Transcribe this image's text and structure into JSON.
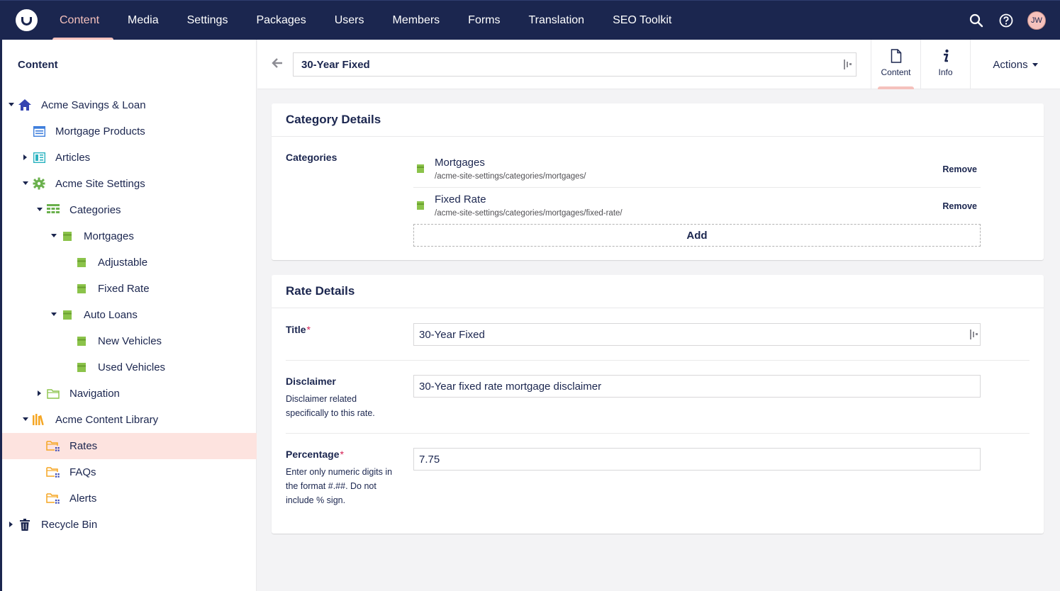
{
  "topnav": {
    "items": [
      "Content",
      "Media",
      "Settings",
      "Packages",
      "Users",
      "Members",
      "Forms",
      "Translation",
      "SEO Toolkit"
    ],
    "active": "Content",
    "avatar_initials": "JW"
  },
  "sidebar": {
    "title": "Content",
    "tree": [
      {
        "label": "Acme Savings & Loan",
        "icon": "home-icon",
        "caret": "down"
      },
      {
        "label": "Mortgage Products",
        "icon": "list-page-icon",
        "caret": ""
      },
      {
        "label": "Articles",
        "icon": "articles-icon",
        "caret": "right"
      },
      {
        "label": "Acme Site Settings",
        "icon": "gear-icon",
        "caret": "down"
      },
      {
        "label": "Categories",
        "icon": "grid-icon",
        "caret": "down"
      },
      {
        "label": "Mortgages",
        "icon": "category-icon",
        "caret": "down"
      },
      {
        "label": "Adjustable",
        "icon": "category-icon",
        "caret": ""
      },
      {
        "label": "Fixed Rate",
        "icon": "category-icon",
        "caret": ""
      },
      {
        "label": "Auto Loans",
        "icon": "category-icon",
        "caret": "down"
      },
      {
        "label": "New Vehicles",
        "icon": "category-icon",
        "caret": ""
      },
      {
        "label": "Used Vehicles",
        "icon": "category-icon",
        "caret": ""
      },
      {
        "label": "Navigation",
        "icon": "folder-icon",
        "caret": "right"
      },
      {
        "label": "Acme Content Library",
        "icon": "library-icon",
        "caret": "down"
      },
      {
        "label": "Rates",
        "icon": "folder-grid-icon",
        "caret": ""
      },
      {
        "label": "FAQs",
        "icon": "folder-grid-icon",
        "caret": ""
      },
      {
        "label": "Alerts",
        "icon": "folder-grid-icon",
        "caret": ""
      },
      {
        "label": "Recycle Bin",
        "icon": "trash-icon",
        "caret": "right"
      }
    ],
    "selected": "Rates"
  },
  "editor": {
    "name": "30-Year Fixed",
    "tabs": {
      "content": "Content",
      "info": "Info"
    },
    "actions_label": "Actions"
  },
  "category_panel": {
    "title": "Category Details",
    "categories_label": "Categories",
    "items": [
      {
        "name": "Mortgages",
        "path": "/acme-site-settings/categories/mortgages/",
        "remove": "Remove"
      },
      {
        "name": "Fixed Rate",
        "path": "/acme-site-settings/categories/mortgages/fixed-rate/",
        "remove": "Remove"
      }
    ],
    "add_label": "Add"
  },
  "rate_panel": {
    "title": "Rate Details",
    "title_label": "Title",
    "title_value": "30-Year Fixed",
    "disclaimer_label": "Disclaimer",
    "disclaimer_desc": "Disclaimer related specifically to this rate.",
    "disclaimer_value": "30-Year fixed rate mortgage disclaimer",
    "percentage_label": "Percentage",
    "percentage_desc": "Enter only numeric digits in the format #.##. Do not include % sign.",
    "percentage_value": "7.75",
    "required_mark": "*"
  },
  "colors": {
    "nav_bg": "#1b264f",
    "accent": "#f5c1bc",
    "selected_bg": "#fde3df",
    "category_green": "#8bc34a",
    "folder_orange": "#f5a623",
    "required_red": "#d42054"
  }
}
